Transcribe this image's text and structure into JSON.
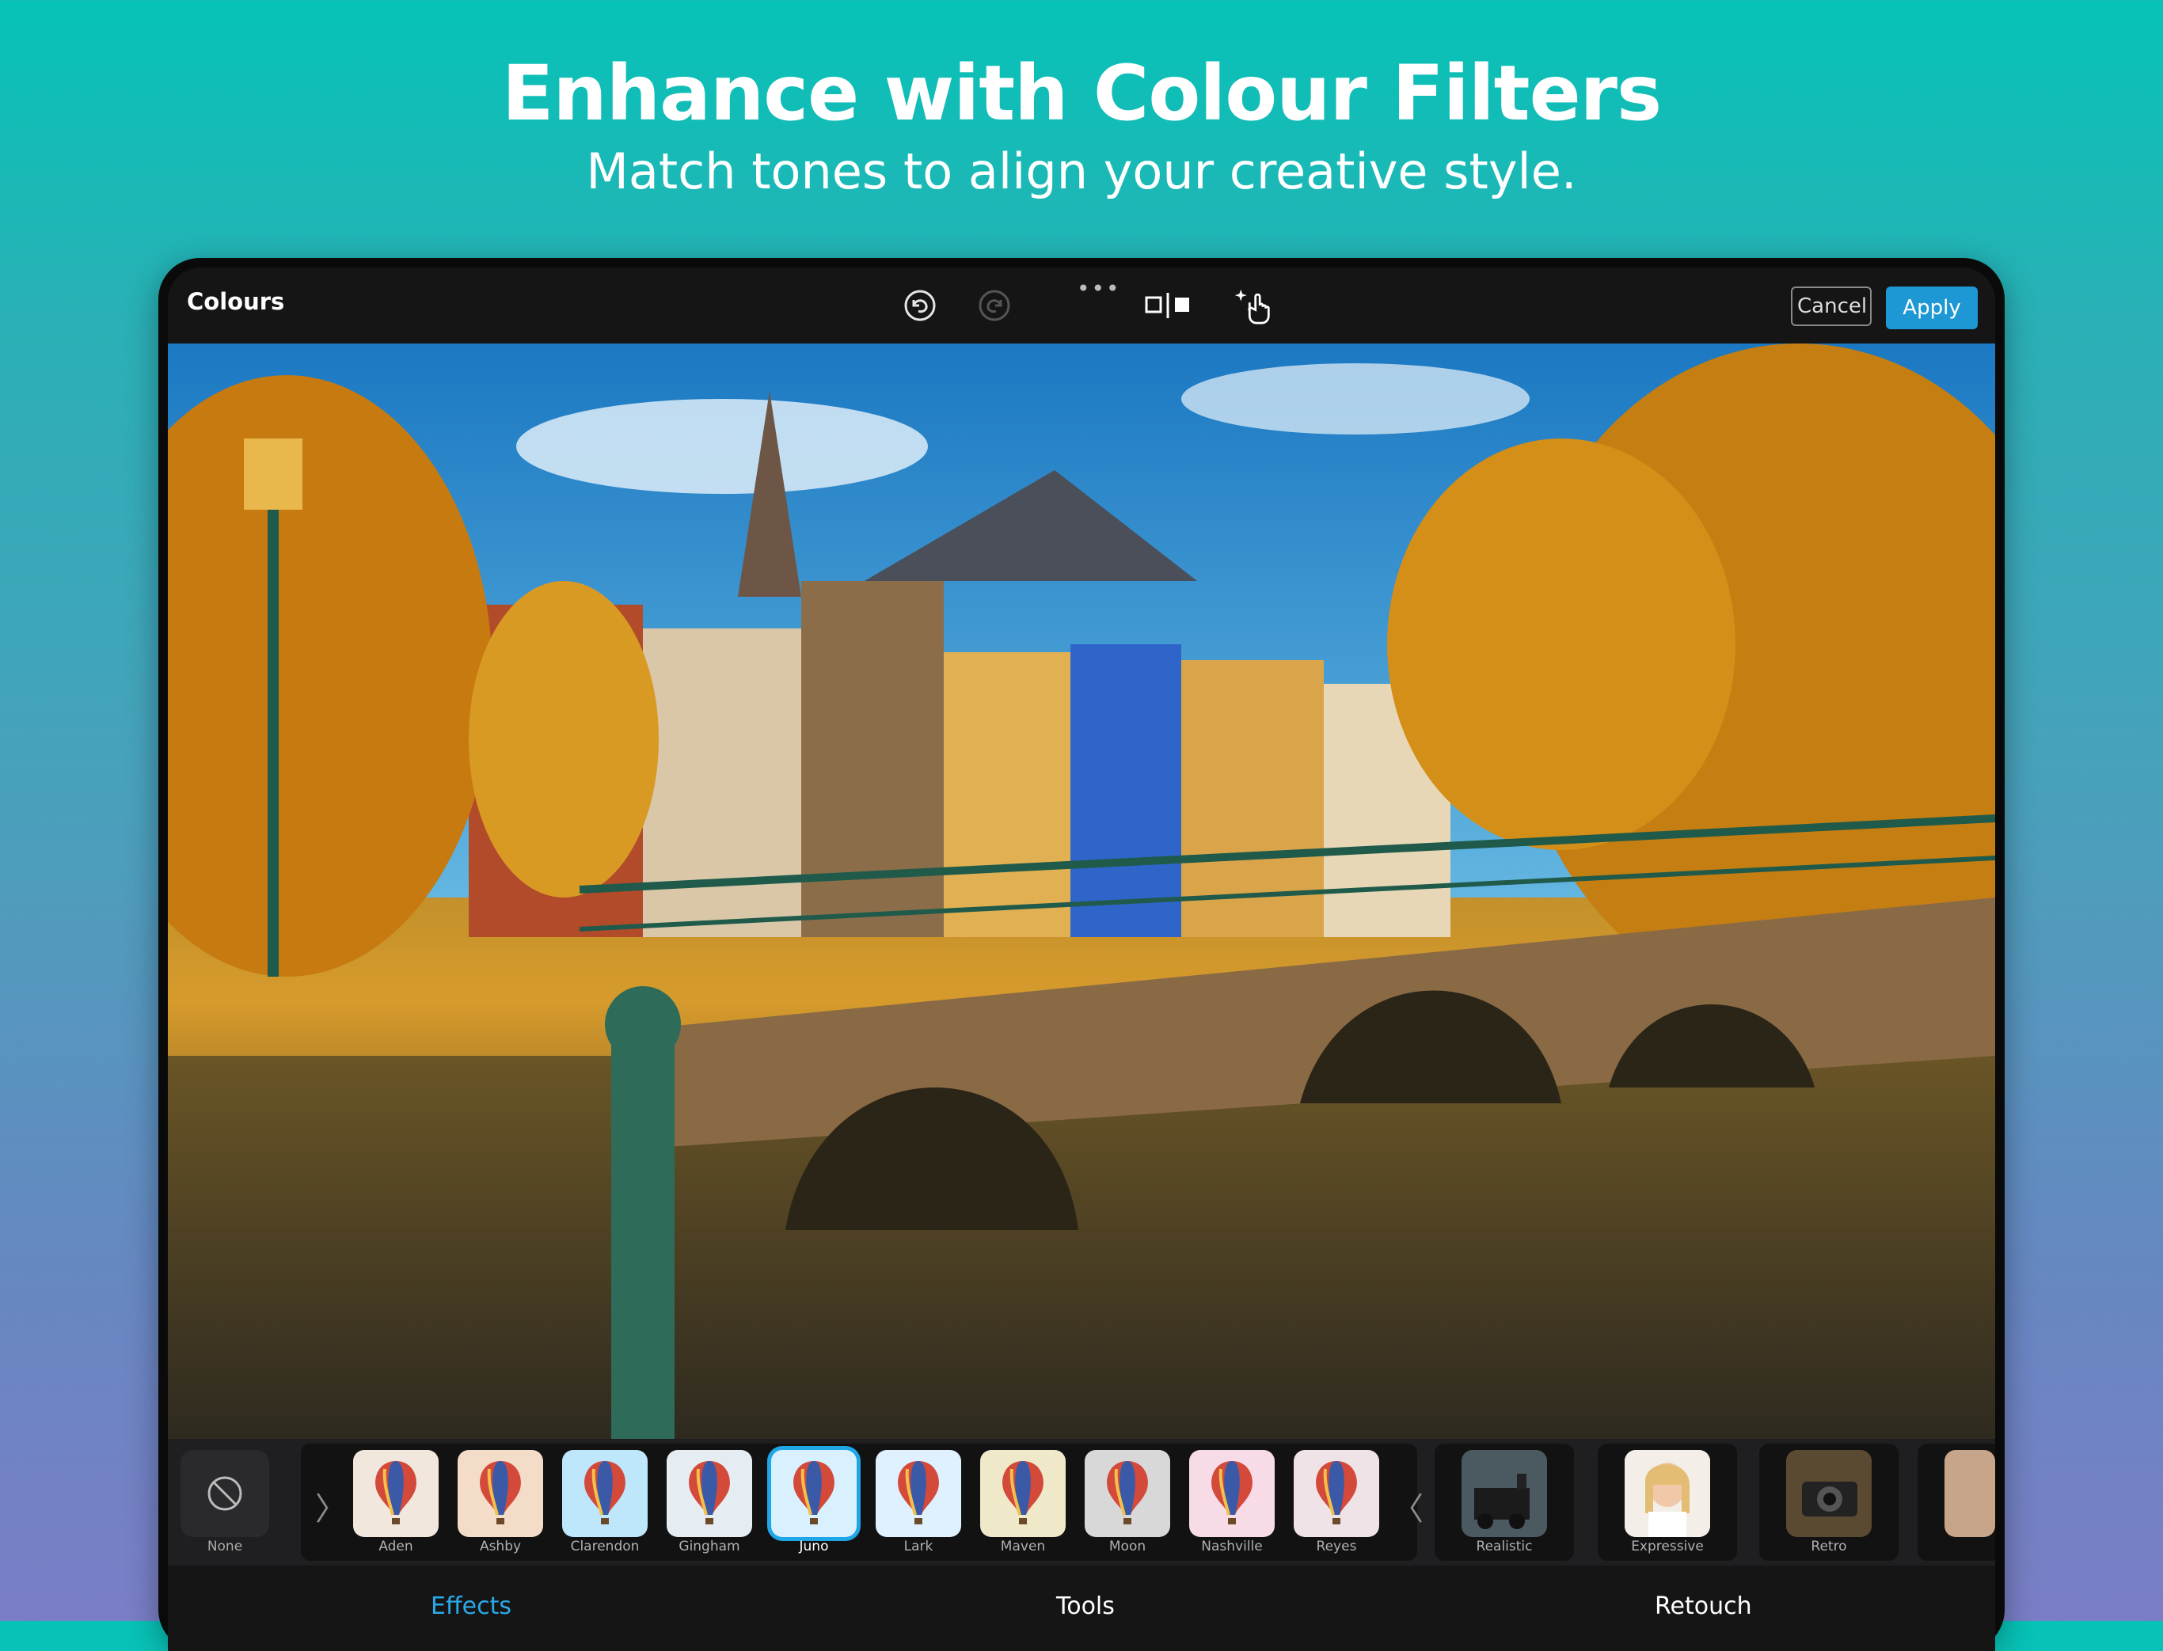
{
  "marketing": {
    "headline": "Enhance with Colour Filters",
    "subline": "Match tones to align your creative style."
  },
  "toolbar": {
    "title": "Colours",
    "cancel_label": "Cancel",
    "apply_label": "Apply",
    "more_dots": "•••"
  },
  "filters": {
    "none_label": "None",
    "items": [
      {
        "label": "Aden",
        "tint": "#f2e7dd"
      },
      {
        "label": "Ashby",
        "tint": "#f3dcc8"
      },
      {
        "label": "Clarendon",
        "tint": "#bfe7fb"
      },
      {
        "label": "Gingham",
        "tint": "#e6edf2"
      },
      {
        "label": "Juno",
        "tint": "#d9f1ff"
      },
      {
        "label": "Lark",
        "tint": "#dff0ff"
      },
      {
        "label": "Maven",
        "tint": "#efe9c9"
      },
      {
        "label": "Moon",
        "tint": "#d8d8d8"
      },
      {
        "label": "Nashville",
        "tint": "#f7dce7"
      },
      {
        "label": "Reyes",
        "tint": "#efe3e7"
      }
    ],
    "selected": "Juno"
  },
  "presets": [
    {
      "label": "Realistic"
    },
    {
      "label": "Expressive"
    },
    {
      "label": "Retro"
    }
  ],
  "tabs": [
    {
      "label": "Effects",
      "active": true
    },
    {
      "label": "Tools",
      "active": false
    },
    {
      "label": "Retouch",
      "active": false
    }
  ],
  "colors": {
    "accent": "#1e98d4",
    "tab_active": "#2aa9e8",
    "selected_ring": "#1ea6e6"
  }
}
